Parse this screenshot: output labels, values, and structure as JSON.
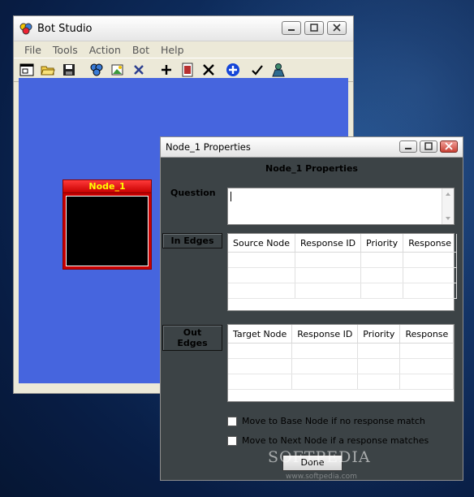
{
  "main_window": {
    "title": "Bot Studio",
    "menu": [
      "File",
      "Tools",
      "Action",
      "Bot",
      "Help"
    ],
    "toolbar_icons": [
      "new-window-icon",
      "open-folder-icon",
      "save-icon",
      "group-icon",
      "image-icon",
      "delete-x-icon",
      "add-icon",
      "record-icon",
      "close-x-icon",
      "add-circle-icon",
      "checkmark-icon",
      "user-icon"
    ]
  },
  "node": {
    "label": "Node_1"
  },
  "props_window": {
    "title": "Node_1 Properties",
    "heading": "Node_1 Properties",
    "question_label": "Question",
    "question_value": "",
    "in_edges_label": "In Edges",
    "in_edges_columns": [
      "Source Node",
      "Response ID",
      "Priority",
      "Response"
    ],
    "out_edges_label": "Out Edges",
    "out_edges_columns": [
      "Target Node",
      "Response ID",
      "Priority",
      "Response"
    ],
    "checkbox_base": "Move to Base Node if no response match",
    "checkbox_next": "Move to Next Node if a response matches",
    "done_label": "Done"
  },
  "watermark": {
    "text": "SOFTPEDIA",
    "sub": "www.softpedia.com"
  }
}
